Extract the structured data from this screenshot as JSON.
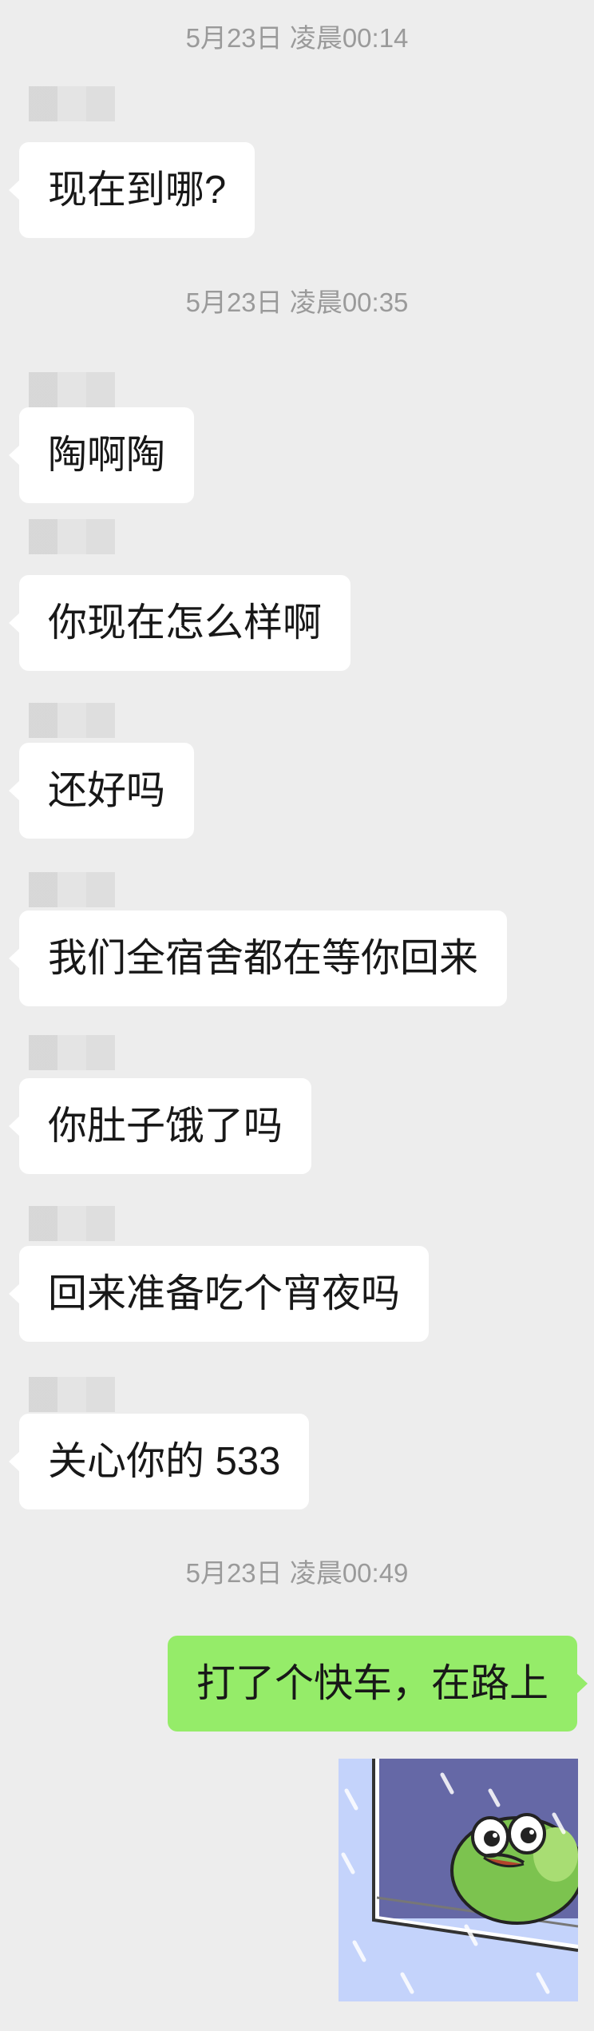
{
  "timestamps": [
    "5月23日 凌晨00:14",
    "5月23日 凌晨00:35",
    "5月23日 凌晨00:49"
  ],
  "messages": [
    {
      "text": "现在到哪?",
      "direction": "incoming"
    },
    {
      "text": "陶啊陶",
      "direction": "incoming"
    },
    {
      "text": "你现在怎么样啊",
      "direction": "incoming"
    },
    {
      "text": "还好吗",
      "direction": "incoming"
    },
    {
      "text": "我们全宿舍都在等你回来",
      "direction": "incoming"
    },
    {
      "text": "你肚子饿了吗",
      "direction": "incoming"
    },
    {
      "text": "回来准备吃个宵夜吗",
      "direction": "incoming"
    },
    {
      "text": "关心你的 533",
      "direction": "incoming"
    },
    {
      "text": "打了个快车，在路上",
      "direction": "outgoing"
    }
  ],
  "sticker": {
    "icon": "frog-at-window-sticker"
  },
  "colors": {
    "background": "#ededed",
    "incoming_bubble": "#ffffff",
    "outgoing_bubble": "#95ec69",
    "timestamp_text": "#9a9a9a"
  }
}
